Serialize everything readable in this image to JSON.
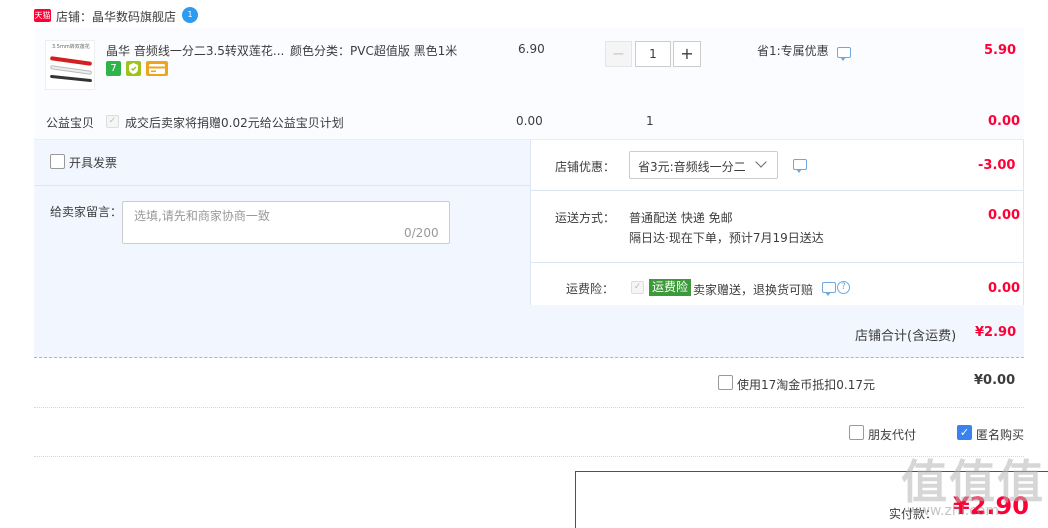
{
  "shop": {
    "logo_text": "天猫",
    "label": "店铺：晶华数码旗舰店",
    "ww_icon": "1"
  },
  "item": {
    "thumb_caption": "3.5mm转双莲花",
    "title": "晶华 音频线一分二3.5转双莲花...",
    "badges": [
      "7",
      "",
      ""
    ],
    "sku": "颜色分类：PVC超值版 黑色1米",
    "unit_price": "6.90",
    "quantity": "1",
    "minus": "−",
    "plus": "+",
    "discount": "省1:专属优惠",
    "total": "5.90"
  },
  "charity": {
    "label": "公益宝贝",
    "checkmark": "✓",
    "text": "成交后卖家将捐赠0.02元给公益宝贝计划",
    "price": "0.00",
    "qty": "1",
    "total": "0.00"
  },
  "invoice": {
    "label": "开具发票"
  },
  "memo": {
    "label": "给卖家留言：",
    "placeholder": "选填,请先和商家协商一致",
    "count": "0/200"
  },
  "coupon": {
    "label": "店铺优惠：",
    "selected": "省3元:音频线一分二",
    "amount": "-3.00"
  },
  "shipping": {
    "label": "运送方式：",
    "line1": "普通配送 快递 免邮",
    "line2": "隔日达·现在下单，预计7月19日送达",
    "amount": "0.00"
  },
  "insurance": {
    "label": "运费险：",
    "checkmark": "✓",
    "badge": "运费险",
    "text": "卖家赠送，退换货可赔",
    "help": "?",
    "amount": "0.00"
  },
  "subtotal": {
    "label": "店铺合计(含运费)",
    "value": "¥2.90"
  },
  "coins": {
    "label": "使用17淘金币抵扣0.17元",
    "value": "¥0.00"
  },
  "options": {
    "friend_pay": "朋友代付",
    "anonymous": "匿名购买",
    "anon_check": "✓"
  },
  "payment": {
    "label": "实付款：",
    "value": "¥2.90"
  },
  "watermark": {
    "big": "值值值",
    "small": "www.zhi.com"
  },
  "colors": {
    "price_red": "#ff0036",
    "panel_blue": "#f2f7ff",
    "checkbox_blue": "#3a82f0",
    "insurance_green": "#3d9a3b"
  }
}
